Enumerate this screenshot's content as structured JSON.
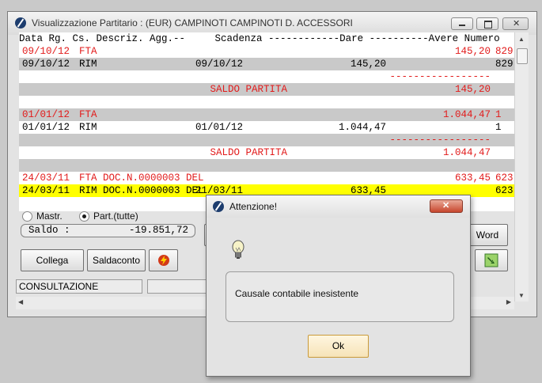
{
  "window": {
    "title": "Visualizzazione Partitario :  (EUR) CAMPINOTI  CAMPINOTI D. ACCESSORI"
  },
  "grid": {
    "header": "Data Rg. Cs. Descriz. Agg.--     Scadenza ------------Dare ----------Avere Numero",
    "rows": [
      {
        "date": "09/10/12",
        "cs": "FTA",
        "desc": "",
        "scad": "",
        "dare": "",
        "avere": "145,20",
        "num": "829",
        "color": "#e21b1b",
        "bg": "#ffffff"
      },
      {
        "date": "09/10/12",
        "cs": "RIM",
        "desc": "",
        "scad": "09/10/12",
        "dare": "145,20",
        "avere": "",
        "num": "829",
        "color": "#000000",
        "bg": "#c9c9c9"
      },
      {
        "date": "",
        "cs": "",
        "desc": "",
        "scad": "",
        "dare": "",
        "avere": "-----------------",
        "num": "",
        "color": "#e21b1b",
        "bg": "#ffffff"
      },
      {
        "date": "",
        "cs": "",
        "desc": "",
        "scad": "SALDO PARTITA",
        "dare": "",
        "avere": "145,20",
        "num": "",
        "color": "#e21b1b",
        "bg": "#c9c9c9"
      },
      {
        "date": "",
        "cs": "",
        "desc": "",
        "scad": "",
        "dare": "",
        "avere": "",
        "num": "",
        "color": "#000000",
        "bg": "#ffffff"
      },
      {
        "date": "01/01/12",
        "cs": "FTA",
        "desc": "",
        "scad": "",
        "dare": "",
        "avere": "1.044,47",
        "num": "1",
        "color": "#e21b1b",
        "bg": "#c9c9c9"
      },
      {
        "date": "01/01/12",
        "cs": "RIM",
        "desc": "",
        "scad": "01/01/12",
        "dare": "1.044,47",
        "avere": "",
        "num": "1",
        "color": "#000000",
        "bg": "#ffffff"
      },
      {
        "date": "",
        "cs": "",
        "desc": "",
        "scad": "",
        "dare": "",
        "avere": "-----------------",
        "num": "",
        "color": "#e21b1b",
        "bg": "#c9c9c9"
      },
      {
        "date": "",
        "cs": "",
        "desc": "",
        "scad": "SALDO PARTITA",
        "dare": "",
        "avere": "1.044,47",
        "num": "",
        "color": "#e21b1b",
        "bg": "#ffffff"
      },
      {
        "date": "",
        "cs": "",
        "desc": "",
        "scad": "",
        "dare": "",
        "avere": "",
        "num": "",
        "color": "#000000",
        "bg": "#c9c9c9"
      },
      {
        "date": "24/03/11",
        "cs": "FTA",
        "desc": "DOC.N.0000003 DEL",
        "scad": "",
        "dare": "",
        "avere": "633,45",
        "num": "623",
        "color": "#e21b1b",
        "bg": "#ffffff"
      },
      {
        "date": "24/03/11",
        "cs": "RIM",
        "desc": "DOC.N.0000003 DEL",
        "scad": "21/03/11",
        "dare": "633,45",
        "avere": "",
        "num": "623",
        "color": "#000000",
        "bg": "#ffff00"
      }
    ]
  },
  "filters": {
    "mastr_label": "Mastr.",
    "part_label": "Part.(tutte)",
    "selected": "part"
  },
  "saldo": {
    "label": "Saldo :",
    "value": "-19.851,72"
  },
  "buttons": {
    "collega": "Collega",
    "saldaconto": "Saldaconto",
    "word": "Word"
  },
  "status": {
    "mode": "CONSULTAZIONE"
  },
  "dialog": {
    "title": "Attenzione!",
    "message": "Causale contabile inesistente",
    "ok": "Ok"
  },
  "icons": {
    "app": "app-logo-icon",
    "bulb": "lightbulb-icon",
    "lightning": "lightning-icon",
    "export": "arrow-down-right-icon"
  }
}
